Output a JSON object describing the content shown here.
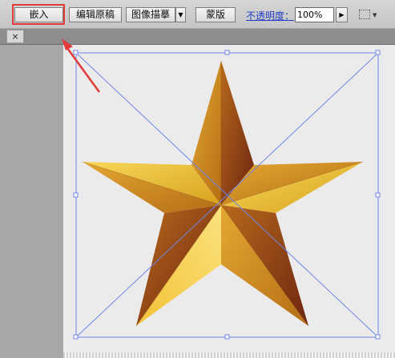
{
  "toolbar": {
    "embed_label": "嵌入",
    "edit_original_label": "编辑原稿",
    "image_trace_label": "图像描摹",
    "mask_label": "蒙版",
    "opacity_label": "不透明度：",
    "opacity_value": "100%"
  },
  "document_tab": {
    "close_label": "×"
  },
  "colors": {
    "highlight": "#e23b3b",
    "selection": "#6f86e6",
    "star_light": "#f2c431",
    "star_dark": "#7a2a10"
  },
  "icons": [
    "close-icon",
    "dropdown-arrow-icon",
    "play-arrow-icon",
    "grid-icon",
    "annotation-arrow-icon"
  ]
}
